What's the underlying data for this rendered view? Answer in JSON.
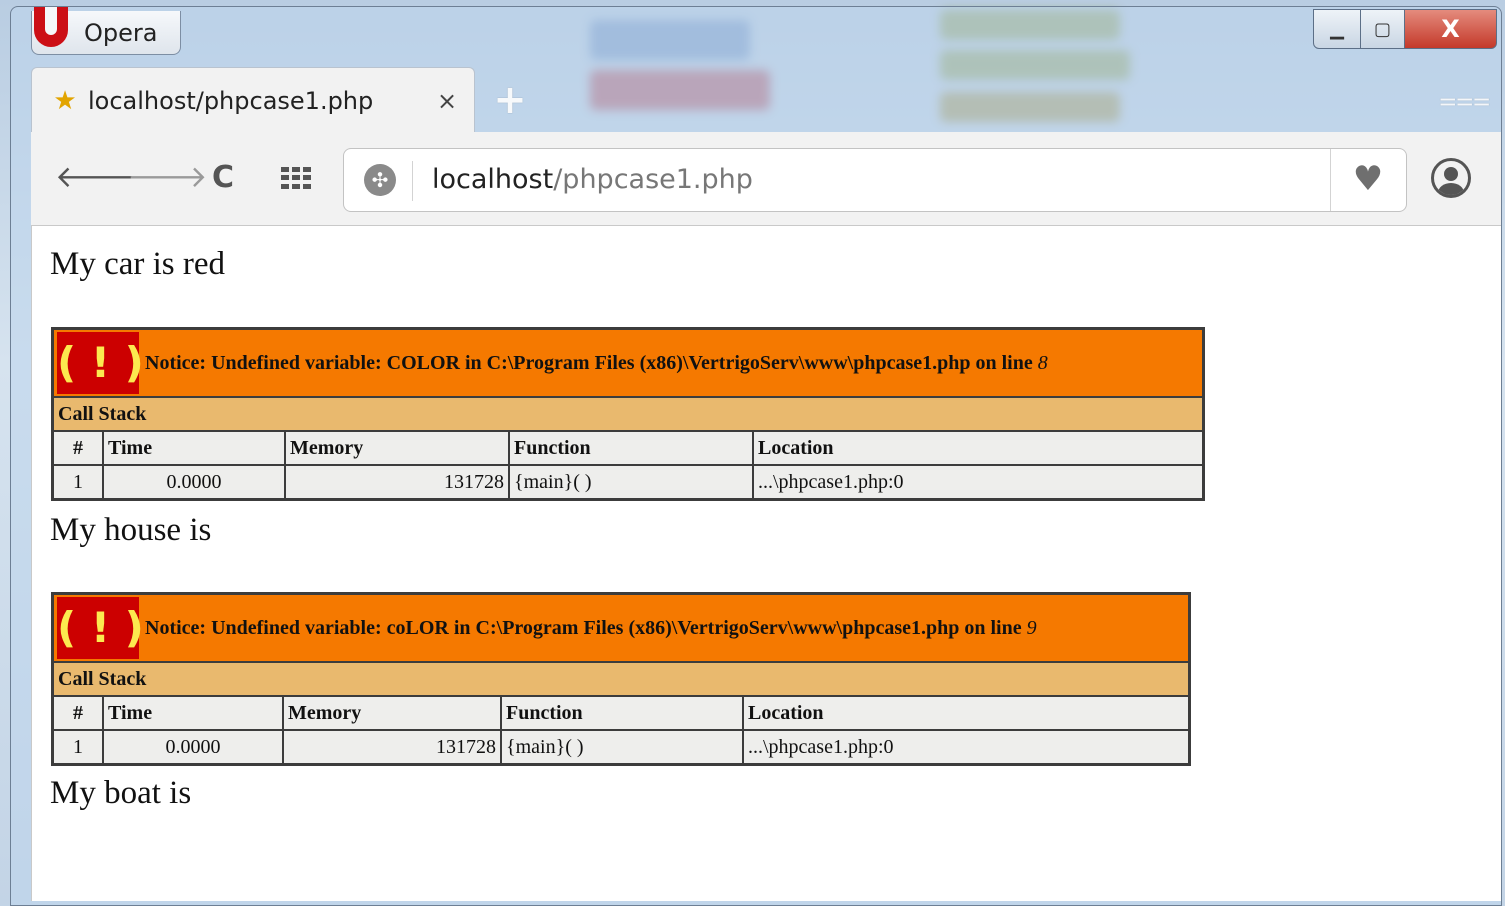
{
  "window": {
    "app_name": "Opera",
    "controls": {
      "minimize": "▁",
      "maximize": "▢",
      "close": "X"
    }
  },
  "tab": {
    "title": "localhost/phpcase1.php",
    "close_glyph": "×",
    "new_tab_glyph": "+"
  },
  "toolbar": {
    "back_glyph": "🡐",
    "forward_glyph": "🡒",
    "reload_glyph": "C",
    "address_host": "localhost",
    "address_path": "/phpcase1.php",
    "heart_glyph": "♥",
    "menu_glyph": "⩶"
  },
  "icons": {
    "star": "star-icon",
    "globe": "globe-icon",
    "heart": "heart-icon",
    "account": "account-icon",
    "speed_dial": "speed-dial-icon"
  },
  "page": {
    "lines": [
      "My car is red",
      "My house is",
      "My boat is"
    ],
    "errors": [
      {
        "icon_text": "( ! )",
        "notice_prefix": "Notice: Undefined variable: COLOR in C:\\Program Files (x86)\\VertrigoServ\\www\\phpcase1.php on line ",
        "line_no": "8",
        "callstack_label": "Call Stack",
        "headers": [
          "#",
          "Time",
          "Memory",
          "Function",
          "Location"
        ],
        "row": [
          "1",
          "0.0000",
          "131728",
          "{main}( )",
          "...\\phpcase1.php:0"
        ]
      },
      {
        "icon_text": "( ! )",
        "notice_prefix": "Notice: Undefined variable: coLOR in C:\\Program Files (x86)\\VertrigoServ\\www\\phpcase1.php on line ",
        "line_no": "9",
        "callstack_label": "Call Stack",
        "headers": [
          "#",
          "Time",
          "Memory",
          "Function",
          "Location"
        ],
        "row": [
          "1",
          "0.0000",
          "131728",
          "{main}( )",
          "...\\phpcase1.php:0"
        ]
      }
    ]
  },
  "colors": {
    "notice_bg": "#f57900",
    "callstack_bg": "#e9b96e",
    "row_bg": "#eeeeec",
    "error_icon_bg": "#cc0000",
    "error_icon_fg": "#fce94f"
  }
}
